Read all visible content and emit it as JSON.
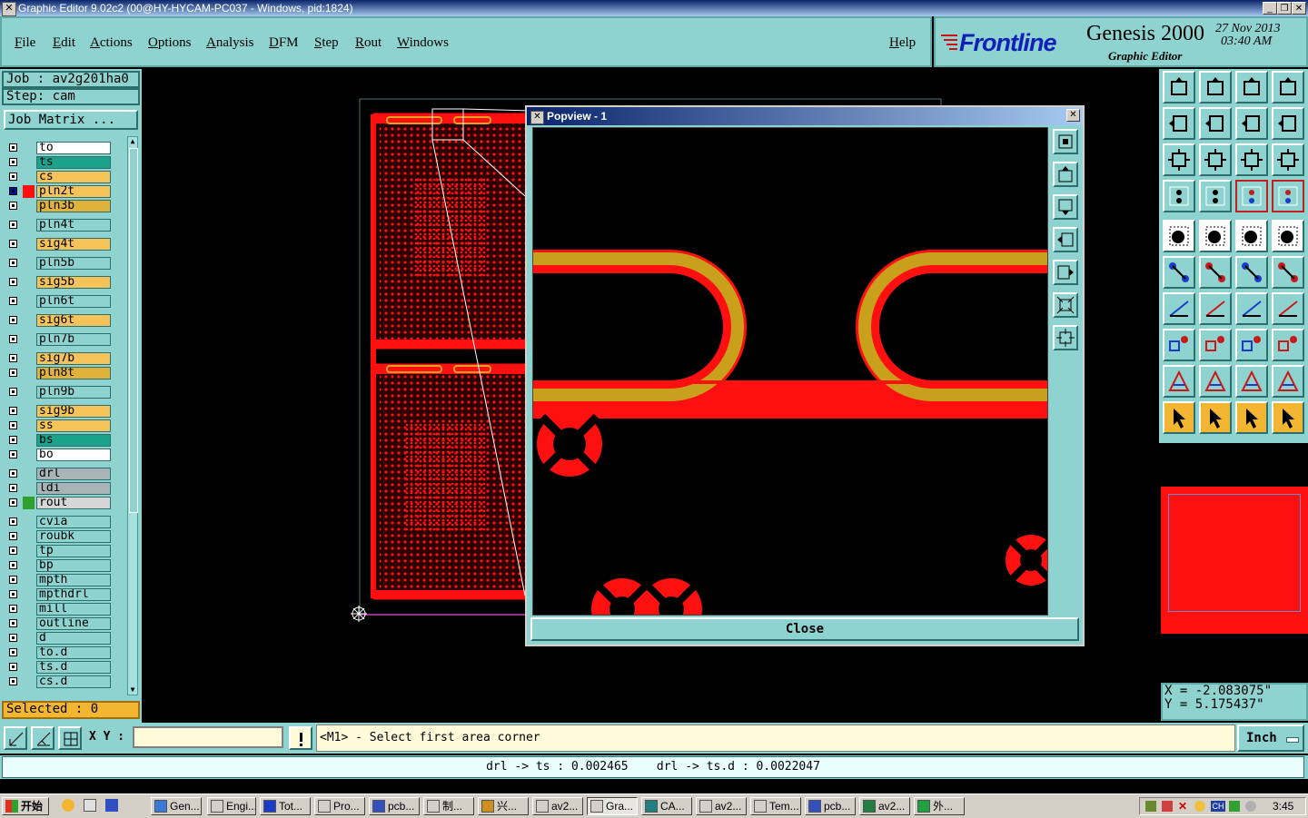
{
  "window": {
    "title": "Graphic Editor 9.02c2 (00@HY-HYCAM-PC037 - Windows, pid:1824)"
  },
  "menu": [
    "File",
    "Edit",
    "Actions",
    "Options",
    "Analysis",
    "DFM",
    "Step",
    "Rout",
    "Windows"
  ],
  "help": "Help",
  "brand": {
    "logo": "Frontline",
    "product": "Genesis 2000",
    "subtitle": "Graphic Editor",
    "date": "27 Nov 2013",
    "time": "03:40 AM"
  },
  "job": {
    "job": "Job : av2g201ha0",
    "step": "Step: cam",
    "matrix": "Job Matrix ..."
  },
  "layers": [
    {
      "name": "to",
      "color": "#ffffff"
    },
    {
      "name": "ts",
      "color": "#1aa38a"
    },
    {
      "name": "cs",
      "color": "#f6c35a"
    },
    {
      "name": "pln2t",
      "color": "#f6c35a",
      "active": true
    },
    {
      "name": "pln3b",
      "color": "#e0b23a"
    },
    {
      "name": "pln4t",
      "color": "#8fd3d0"
    },
    {
      "name": "sig4t",
      "color": "#f6c35a"
    },
    {
      "name": "pln5b",
      "color": "#8fd3d0"
    },
    {
      "name": "sig5b",
      "color": "#f6c35a"
    },
    {
      "name": "pln6t",
      "color": "#8fd3d0"
    },
    {
      "name": "sig6t",
      "color": "#f6c35a"
    },
    {
      "name": "pln7b",
      "color": "#8fd3d0"
    },
    {
      "name": "sig7b",
      "color": "#f6c35a"
    },
    {
      "name": "pln8t",
      "color": "#e0b23a"
    },
    {
      "name": "pln9b",
      "color": "#8fd3d0"
    },
    {
      "name": "sig9b",
      "color": "#f6c35a"
    },
    {
      "name": "ss",
      "color": "#f6c35a"
    },
    {
      "name": "bs",
      "color": "#1aa38a"
    },
    {
      "name": "bo",
      "color": "#ffffff"
    },
    {
      "name": "drl",
      "color": "#a9b4b8"
    },
    {
      "name": "ldi",
      "color": "#a9b4b8"
    },
    {
      "name": "rout",
      "color": "#d6d6d6"
    },
    {
      "name": "cvia",
      "color": "#8fd3d0"
    },
    {
      "name": "roubk",
      "color": "#8fd3d0"
    },
    {
      "name": "tp",
      "color": "#8fd3d0"
    },
    {
      "name": "bp",
      "color": "#8fd3d0"
    },
    {
      "name": "mpth",
      "color": "#8fd3d0"
    },
    {
      "name": "mpthdrl",
      "color": "#8fd3d0"
    },
    {
      "name": "mill",
      "color": "#8fd3d0"
    },
    {
      "name": "outline",
      "color": "#8fd3d0"
    },
    {
      "name": "d",
      "color": "#8fd3d0"
    },
    {
      "name": "to.d",
      "color": "#8fd3d0"
    },
    {
      "name": "ts.d",
      "color": "#8fd3d0"
    },
    {
      "name": "cs.d",
      "color": "#8fd3d0"
    }
  ],
  "selected": "Selected : 0",
  "popview": {
    "title": "Popview - 1",
    "close": "Close"
  },
  "coords": {
    "x": "X = -2.083075\"",
    "y": "Y = 5.175437\""
  },
  "cmd": {
    "xy_label": "X Y :",
    "xy_value": "",
    "prompt": "<M1> - Select first area corner",
    "unit": "Inch"
  },
  "status": "drl -> ts : 0.002465    drl -> ts.d : 0.0022047",
  "taskbar": {
    "start": "开始",
    "items": [
      "Gen...",
      "Engi...",
      "Tot...",
      "Pro...",
      "pcb...",
      "制...",
      "兴...",
      "av2...",
      "Gra...",
      "CA...",
      "av2...",
      "Tem...",
      "pcb...",
      "av2...",
      "外..."
    ],
    "clock": "3:45"
  }
}
